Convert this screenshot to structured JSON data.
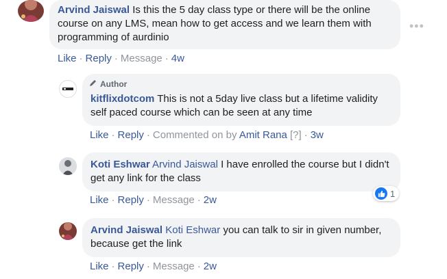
{
  "comments": [
    {
      "author": "Arvind Jaiswal",
      "text": "Is this the 5 day class type or there will be the online course on any LMS, mean how to get access and we learn them with programming of aurdinio",
      "actions": {
        "like": "Like",
        "reply": "Reply",
        "message": "Message",
        "time": "4w"
      }
    },
    {
      "author_tag": "Author",
      "author": "kitflixdotcom",
      "text": "This is not a 5day live class but a lifetime validity self paced course which can be seen at any time",
      "actions": {
        "like": "Like",
        "reply": "Reply",
        "commented_on": "Commented on by",
        "commented_by": "Amit Rana",
        "help": "[?]",
        "time": "3w"
      }
    },
    {
      "author": "Koti Eshwar",
      "mention": "Arvind Jaiswal",
      "text": "I have enrolled the course but I didn't get any link for the class",
      "reaction_count": "1",
      "actions": {
        "like": "Like",
        "reply": "Reply",
        "message": "Message",
        "time": "2w"
      }
    },
    {
      "author": "Arvind Jaiswal",
      "mention": "Koti Eshwar",
      "text": "you can talk to sir in given number, because get the link",
      "actions": {
        "like": "Like",
        "reply": "Reply",
        "message": "Message",
        "time": "2w"
      }
    }
  ],
  "icons": {
    "more": "more-options-icon",
    "author": "pencil-icon",
    "reaction": "thumbs-up-icon"
  },
  "colors": {
    "link": "#385898",
    "bubble": "#f2f3f5",
    "reaction": "#1877f2"
  }
}
